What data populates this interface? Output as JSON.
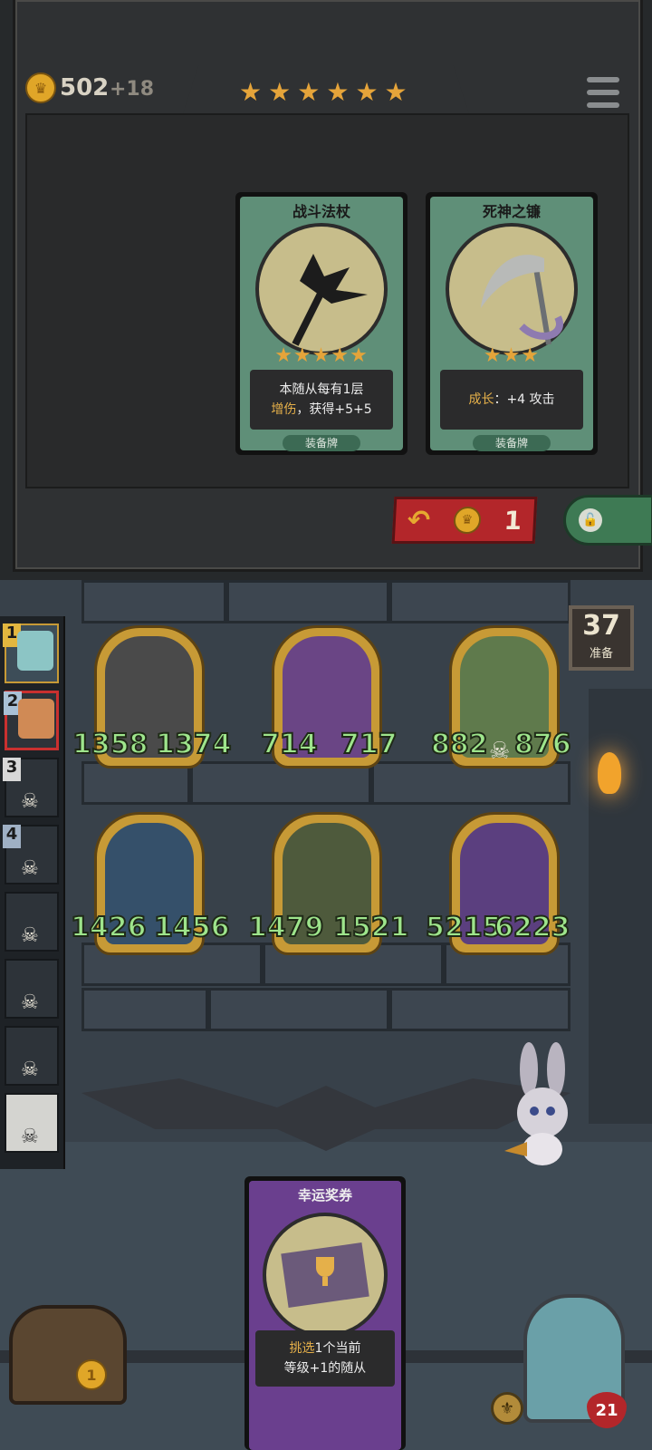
{
  "header": {
    "gold": "502",
    "gold_income": "+18",
    "tavern_stars": 6
  },
  "shop_cards": [
    {
      "title": "战斗法杖",
      "stars": "★★★★★",
      "desc_line1": "本随从每有1层",
      "desc_line2_highlight": "增伤",
      "desc_line2_rest": "，获得+5+5",
      "tag": "装备牌"
    },
    {
      "title": "死神之镰",
      "stars": "★★★",
      "desc_highlight": "成长",
      "desc_rest": "：+4 攻击",
      "tag": "装备牌"
    }
  ],
  "buttons": {
    "refresh_cost": "1"
  },
  "turn": {
    "value": "37",
    "label": "准备"
  },
  "sidebar": [
    {
      "rank": "1",
      "state": "active"
    },
    {
      "rank": "2",
      "state": "self"
    },
    {
      "rank": "3",
      "state": "dead"
    },
    {
      "rank": "4",
      "state": "dead"
    },
    {
      "rank": "",
      "state": "dead"
    },
    {
      "rank": "",
      "state": "dead"
    },
    {
      "rank": "",
      "state": "dead"
    },
    {
      "rank": "",
      "state": "dead"
    }
  ],
  "minions": [
    {
      "name": "warlord-box",
      "attack": "1358",
      "health": "1374"
    },
    {
      "name": "airship",
      "attack": "714",
      "health": "717"
    },
    {
      "name": "flower-witch",
      "attack": "882",
      "health": "876"
    },
    {
      "name": "naga-sorceress",
      "attack": "1426",
      "health": "1456"
    },
    {
      "name": "goblin-sniper",
      "attack": "1479",
      "health": "1521"
    },
    {
      "name": "forest-fairy",
      "attack": "5215",
      "health": "6223"
    }
  ],
  "reward_card": {
    "title": "幸运奖券",
    "line1_highlight": "挑选",
    "line1_rest": "1个当前",
    "line2": "等级+1的随从"
  },
  "bottom": {
    "chest_count": "1",
    "hero_health": "21"
  },
  "colors": {
    "gold": "#e0a628",
    "stat_green": "#9ee58c",
    "equip_card": "#5f8f78",
    "reward_card": "#6a3f8e",
    "refresh_red": "#b3262a",
    "lock_green": "#3e7a54"
  }
}
